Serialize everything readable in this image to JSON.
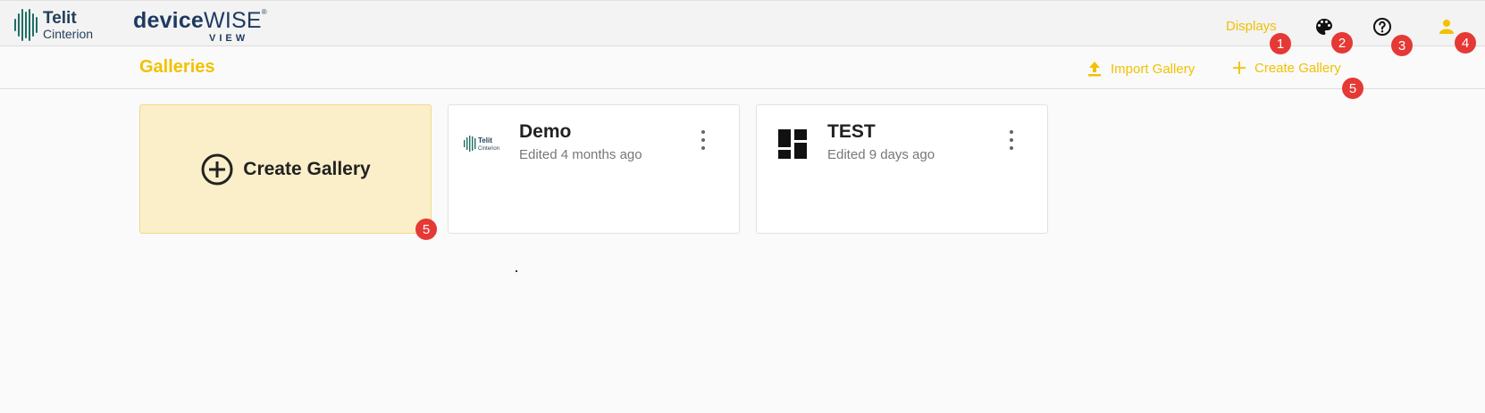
{
  "header": {
    "brand_primary": "Telit",
    "brand_secondary": "Cinterion",
    "product_bold": "device",
    "product_light": "WISE",
    "product_reg": "®",
    "product_sub": "VIEW",
    "nav_displays": "Displays",
    "icons": [
      "palette-icon",
      "help-icon",
      "account-icon"
    ]
  },
  "subheader": {
    "title": "Galleries",
    "import_label": "Import Gallery",
    "create_label": "Create Gallery"
  },
  "cards": {
    "create": {
      "label": "Create Gallery"
    },
    "items": [
      {
        "title": "Demo",
        "subtitle": "Edited 4 months ago",
        "thumb": "telit-logo"
      },
      {
        "title": "TEST",
        "subtitle": "Edited 9 days ago",
        "thumb": "dashboard-icon"
      }
    ]
  },
  "badges": [
    "1",
    "2",
    "3",
    "4",
    "5",
    "5"
  ],
  "colors": {
    "accent": "#f2c100",
    "badge": "#e53935",
    "brand": "#1f3f5a",
    "create_card": "#fbefc9"
  }
}
